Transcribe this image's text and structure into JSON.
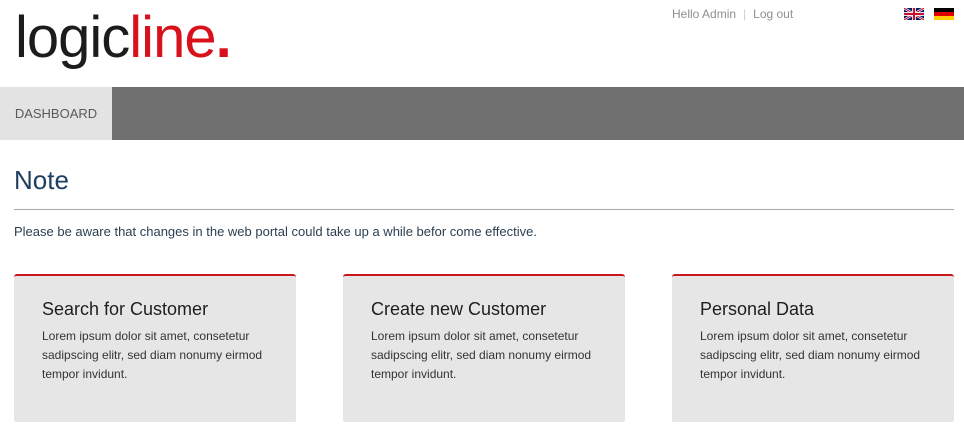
{
  "header": {
    "logo_part1": "logic",
    "logo_part2": "line",
    "logo_dot": ".",
    "greeting": "Hello Admin",
    "separator": "|",
    "logout_label": "Log out",
    "languages": [
      {
        "icon": "uk-flag-icon",
        "code": "en"
      },
      {
        "icon": "german-flag-icon",
        "code": "de"
      }
    ]
  },
  "nav": {
    "items": [
      {
        "label": "DASHBOARD",
        "active": true
      }
    ]
  },
  "main": {
    "title": "Note",
    "note": "Please be aware that changes in the web portal could take up a while befor come effective.",
    "cards": [
      {
        "title": "Search for Customer",
        "text": "Lorem ipsum dolor sit amet, consetetur sadipscing elitr, sed diam nonumy eirmod tempor invidunt."
      },
      {
        "title": "Create new Customer",
        "text": "Lorem ipsum dolor sit amet, consetetur sadipscing elitr, sed diam nonumy eirmod tempor invidunt."
      },
      {
        "title": "Personal Data",
        "text": "Lorem ipsum dolor sit amet, consetetur sadipscing elitr, sed diam nonumy eirmod tempor invidunt."
      }
    ]
  },
  "colors": {
    "brand_red": "#d8121c",
    "card_border": "#c8161d",
    "nav_bar": "#707070",
    "title_blue": "#1d3e5e"
  }
}
